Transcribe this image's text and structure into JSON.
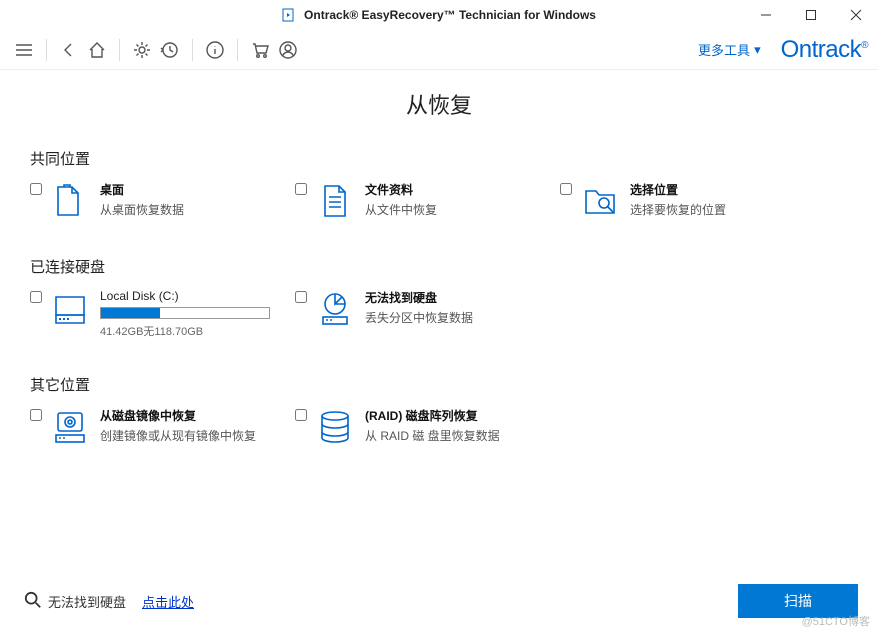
{
  "window": {
    "title": "Ontrack® EasyRecovery™ Technician for Windows"
  },
  "toolbar": {
    "more_tools": "更多​工具",
    "brand": "Ontrack"
  },
  "page": {
    "title": "从恢复"
  },
  "sections": {
    "common": {
      "title": "共同位置",
      "desktop": {
        "title": "桌面",
        "desc": "从桌面恢复数据"
      },
      "documents": {
        "title": "文件资料",
        "desc": "从​文件​中​恢复"
      },
      "location": {
        "title": "选择位置",
        "desc": "选择​要​恢复​的​位置"
      }
    },
    "drives": {
      "title": "已​连​接​硬​盘",
      "disk": {
        "name": "Local Disk (C:)",
        "size": "41.42GB无118.70GB",
        "pct": 35
      },
      "lost": {
        "title": "无法​找到​硬盘",
        "desc": "丢失​分区​中​恢复​数据"
      }
    },
    "other": {
      "title": "其它位置",
      "image": {
        "title": "从​磁盘​镜像​中​恢复",
        "desc": "创建​镜像​或​从​现有​镜像​中​恢复"
      },
      "raid": {
        "title": "(RAID) 磁盘​阵列​恢复",
        "desc": "从 RAID 磁 盘​里​恢复​数据"
      }
    }
  },
  "footer": {
    "cant_find": "无法​找到​硬盘",
    "click_here": "点击​此处",
    "scan": "扫描"
  },
  "watermark": "@51CTO博客"
}
